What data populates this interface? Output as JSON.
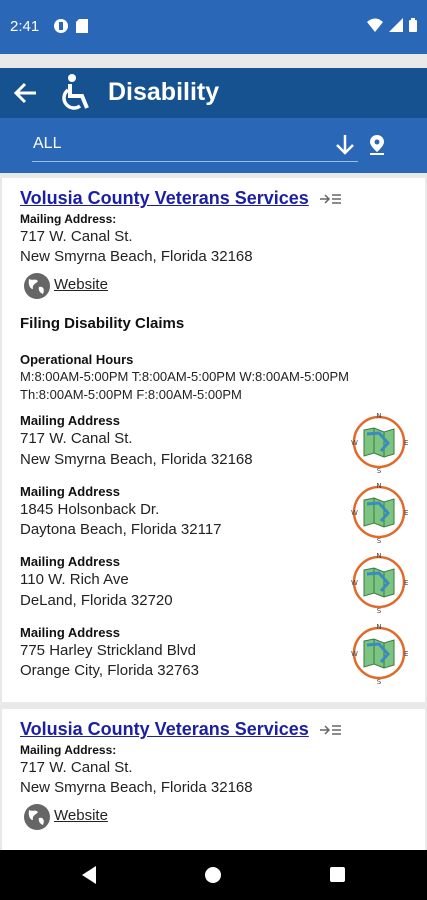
{
  "status_bar": {
    "time": "2:41"
  },
  "app_bar": {
    "title": "Disability"
  },
  "filter": {
    "value": "ALL"
  },
  "card1": {
    "org_name": "Volusia County Veterans Services",
    "mailing_label": "Mailing Address:",
    "addr1": "717 W. Canal St.",
    "addr2": "New Smyrna Beach, Florida 32168",
    "website": "Website",
    "service_title": "Filing Disability Claims",
    "hours_label": "Operational Hours",
    "hours1": "M:8:00AM-5:00PM T:8:00AM-5:00PM W:8:00AM-5:00PM",
    "hours2": "Th:8:00AM-5:00PM F:8:00AM-5:00PM",
    "locations": [
      {
        "label": "Mailing Address",
        "line1": "717 W. Canal St.",
        "line2": "New Smyrna Beach, Florida 32168"
      },
      {
        "label": "Mailing Address",
        "line1": "1845 Holsonback Dr.",
        "line2": "Daytona Beach, Florida 32117"
      },
      {
        "label": "Mailing Address",
        "line1": "110 W. Rich Ave",
        "line2": "DeLand, Florida 32720"
      },
      {
        "label": "Mailing Address",
        "line1": "775 Harley Strickland Blvd",
        "line2": "Orange City, Florida 32763"
      }
    ]
  },
  "card2": {
    "org_name": "Volusia County Veterans Services",
    "mailing_label": "Mailing Address:",
    "addr1": "717 W. Canal St.",
    "addr2": "New Smyrna Beach, Florida 32168",
    "website": "Website"
  },
  "colors": {
    "status_bar": "#2a67b7",
    "app_bar": "#16528f",
    "link": "#1b1fa3"
  }
}
